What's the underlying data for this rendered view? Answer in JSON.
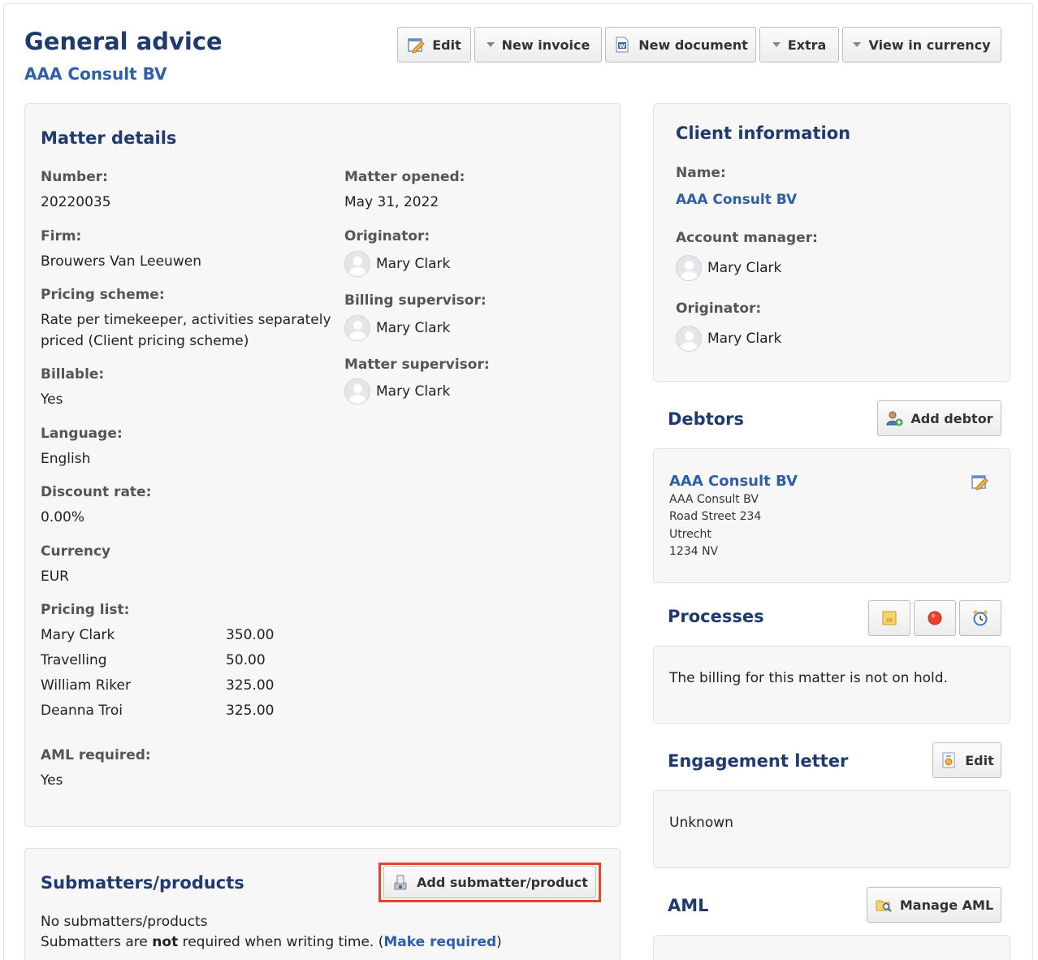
{
  "header": {
    "title": "General advice",
    "subtitle": "AAA Consult BV"
  },
  "toolbar": {
    "edit": "Edit",
    "new_invoice": "New invoice",
    "new_document": "New document",
    "extra": "Extra",
    "view_in_currency": "View in currency"
  },
  "matter": {
    "title": "Matter details",
    "number_label": "Number:",
    "number": "20220035",
    "firm_label": "Firm:",
    "firm": "Brouwers Van Leeuwen",
    "pricing_scheme_label": "Pricing scheme:",
    "pricing_scheme_line1": "Rate per timekeeper, activities separately",
    "pricing_scheme_line2": "priced (Client pricing scheme)",
    "billable_label": "Billable:",
    "billable": "Yes",
    "language_label": "Language:",
    "language": "English",
    "discount_label": "Discount rate:",
    "discount": "0.00%",
    "currency_label": "Currency",
    "currency": "EUR",
    "pricing_list_label": "Pricing list:",
    "pricing_list": [
      {
        "name": "Mary Clark",
        "rate": "350.00"
      },
      {
        "name": "Travelling",
        "rate": "50.00"
      },
      {
        "name": "William Riker",
        "rate": "325.00"
      },
      {
        "name": "Deanna Troi",
        "rate": "325.00"
      }
    ],
    "aml_label": "AML required:",
    "aml": "Yes",
    "opened_label": "Matter opened:",
    "opened": "May 31, 2022",
    "originator_label": "Originator:",
    "originator": "Mary Clark",
    "billing_supervisor_label": "Billing supervisor:",
    "billing_supervisor": "Mary Clark",
    "matter_supervisor_label": "Matter supervisor:",
    "matter_supervisor": "Mary Clark"
  },
  "submatters": {
    "title": "Submatters/products",
    "add_button": "Add submatter/product",
    "empty": "No submatters/products",
    "note_prefix": "Submatters are ",
    "note_bold": "not",
    "note_suffix": " required when writing time. (",
    "make_required": "Make required",
    "note_end": ")"
  },
  "client": {
    "title": "Client information",
    "name_label": "Name:",
    "name": "AAA Consult BV",
    "account_manager_label": "Account manager:",
    "account_manager": "Mary Clark",
    "originator_label": "Originator:",
    "originator": "Mary Clark"
  },
  "debtors": {
    "title": "Debtors",
    "add_button": "Add debtor",
    "name": "AAA Consult BV",
    "address": [
      "AAA Consult BV",
      "Road Street 234",
      "Utrecht",
      "1234 NV"
    ]
  },
  "processes": {
    "title": "Processes",
    "status": "The billing for this matter is not on hold."
  },
  "engagement": {
    "title": "Engagement letter",
    "edit_button": "Edit",
    "status": "Unknown"
  },
  "aml": {
    "title": "AML",
    "manage_button": "Manage AML"
  },
  "colors": {
    "title": "#1f3a6e",
    "link": "#2f5ea8",
    "highlight": "#e2462a"
  }
}
